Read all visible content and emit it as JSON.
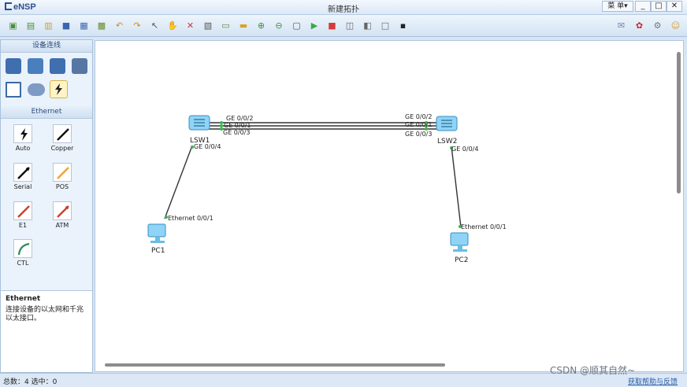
{
  "app": {
    "name": "eNSP",
    "window_title": "新建拓扑",
    "menu_label": "菜 单▾"
  },
  "window_controls": {
    "minimize": "_",
    "maximize": "□",
    "close": "✕"
  },
  "toolbar": {
    "buttons": [
      {
        "name": "new-topology-icon",
        "color": "#4d8f3b"
      },
      {
        "name": "new-example-icon",
        "color": "#4d8f3b"
      },
      {
        "name": "open-icon",
        "color": "#c9a03a"
      },
      {
        "name": "save-icon",
        "color": "#3a66b1"
      },
      {
        "name": "save-as-icon",
        "color": "#3a66b1"
      },
      {
        "name": "print-icon",
        "color": "#6a8c2a"
      },
      {
        "name": "undo-icon",
        "color": "#d18c18"
      },
      {
        "name": "redo-icon",
        "color": "#d18c18"
      },
      {
        "name": "select-icon",
        "color": "#555555"
      },
      {
        "name": "hand-icon",
        "color": "#d59a35"
      },
      {
        "name": "delete-icon",
        "color": "#d03535"
      },
      {
        "name": "delete-link-icon",
        "color": "#555555"
      },
      {
        "name": "text-note-icon",
        "color": "#5b8a3c"
      },
      {
        "name": "palette-icon",
        "color": "#d6a32a"
      },
      {
        "name": "zoom-in-icon",
        "color": "#3f8f3f"
      },
      {
        "name": "zoom-out-icon",
        "color": "#3f8f3f"
      },
      {
        "name": "fit-view-icon",
        "color": "#555555"
      },
      {
        "name": "start-device-icon",
        "color": "#39a745"
      },
      {
        "name": "stop-device-icon",
        "color": "#d63a3a"
      },
      {
        "name": "capture-icon",
        "color": "#666666"
      },
      {
        "name": "topology-icon",
        "color": "#666666"
      },
      {
        "name": "blank-icon",
        "color": "#666666"
      },
      {
        "name": "cli-icon",
        "color": "#222222"
      }
    ],
    "right_buttons": [
      {
        "name": "chat-icon",
        "color": "#6f84a6"
      },
      {
        "name": "huawei-icon",
        "color": "#c62a2a"
      },
      {
        "name": "settings-icon",
        "color": "#777777"
      },
      {
        "name": "help-icon",
        "color": "#d89a22"
      }
    ]
  },
  "sidebar": {
    "devices_title": "设备连线",
    "devices": [
      {
        "name": "router-category-icon"
      },
      {
        "name": "switch-category-icon"
      },
      {
        "name": "wlan-category-icon"
      },
      {
        "name": "firewall-category-icon"
      },
      {
        "name": "pc-category-icon"
      },
      {
        "name": "cloud-category-icon"
      },
      {
        "name": "cable-category-icon"
      }
    ],
    "cables_title": "Ethernet",
    "cables": [
      {
        "label": "Auto",
        "icon": "auto-cable-icon"
      },
      {
        "label": "Copper",
        "icon": "copper-cable-icon"
      },
      {
        "label": "Serial",
        "icon": "serial-cable-icon"
      },
      {
        "label": "POS",
        "icon": "pos-cable-icon"
      },
      {
        "label": "E1",
        "icon": "e1-cable-icon"
      },
      {
        "label": "ATM",
        "icon": "atm-cable-icon"
      },
      {
        "label": "CTL",
        "icon": "ctl-cable-icon"
      }
    ],
    "description": {
      "title": "Ethernet",
      "text": "连接设备的以太网和千兆以太接口。"
    }
  },
  "canvas": {
    "nodes": [
      {
        "id": "LSW1",
        "label": "LSW1",
        "type": "switch"
      },
      {
        "id": "LSW2",
        "label": "LSW2",
        "type": "switch"
      },
      {
        "id": "PC1",
        "label": "PC1",
        "type": "pc"
      },
      {
        "id": "PC2",
        "label": "PC2",
        "type": "pc"
      }
    ],
    "ports": {
      "lsw1_g2": "GE 0/0/2",
      "lsw1_g1": "GE 0/0/1",
      "lsw1_g3": "GE 0/0/3",
      "lsw1_g4": "GE 0/0/4",
      "lsw2_g2": "GE 0/0/2",
      "lsw2_g1": "GE 0/0/1",
      "lsw2_g3": "GE 0/0/3",
      "lsw2_g4": "GE 0/0/4",
      "pc1_eth": "Ethernet 0/0/1",
      "pc2_eth": "Ethernet 0/0/1"
    }
  },
  "statusbar": {
    "left": "总数：4  选中：0",
    "right": "获取帮助与反馈"
  },
  "watermark": "CSDN @顺其自然~"
}
